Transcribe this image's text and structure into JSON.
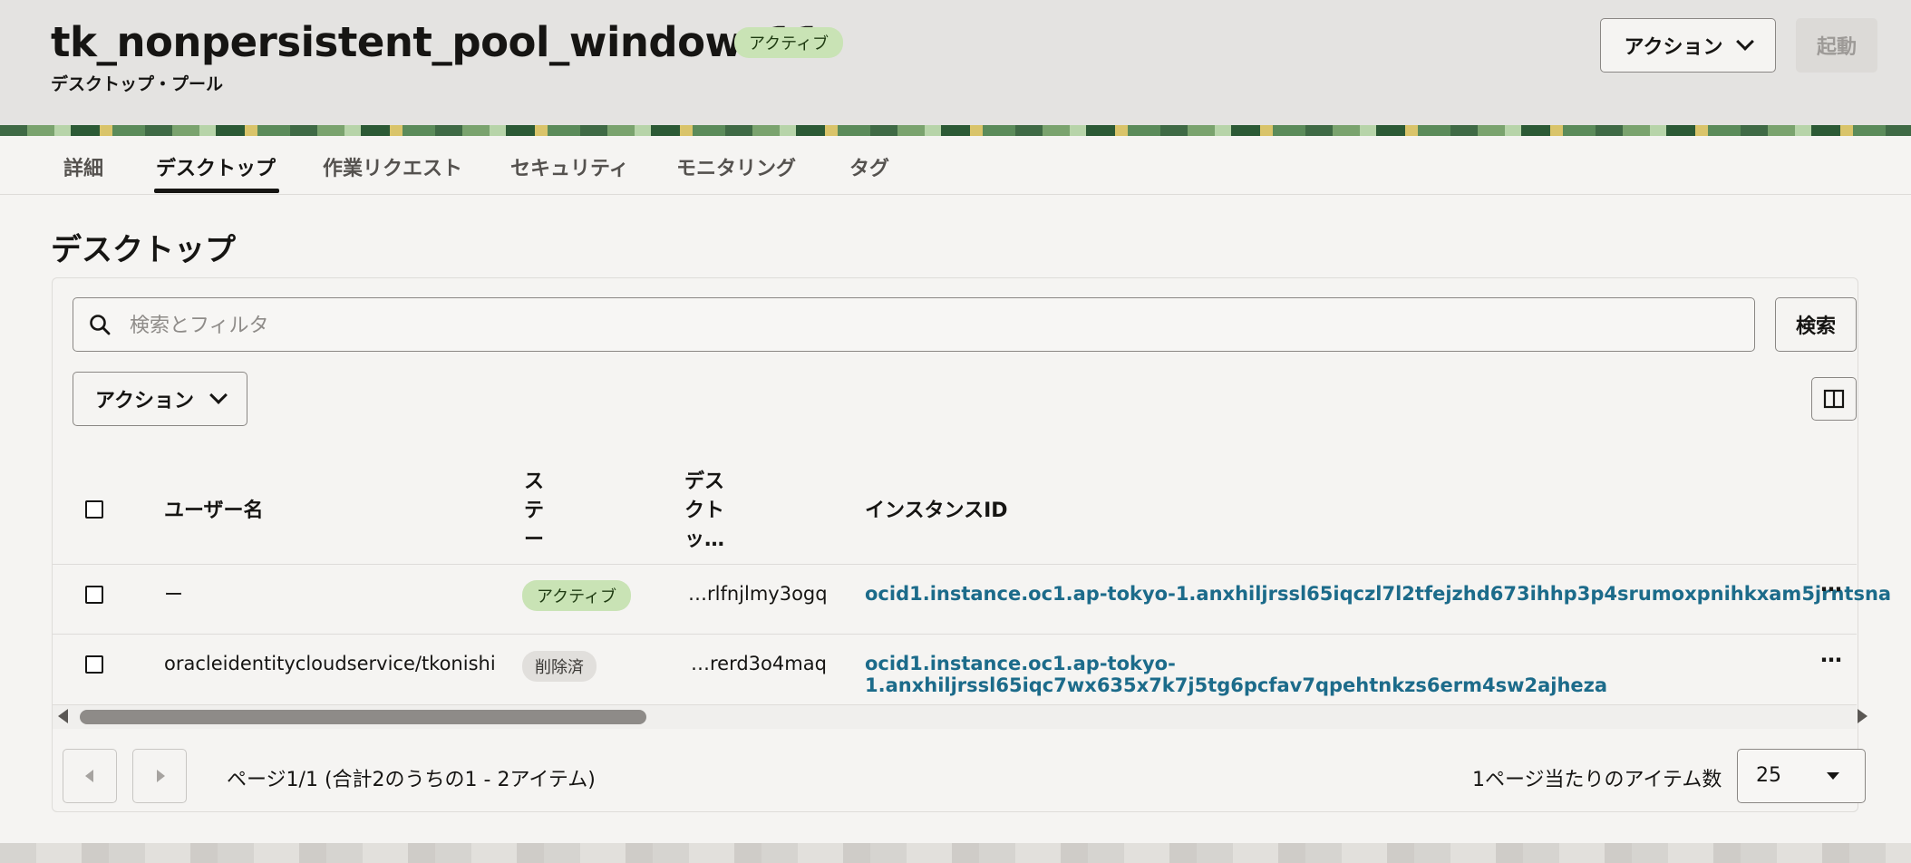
{
  "header": {
    "title": "tk_nonpersistent_pool_windows11",
    "status": "アクティブ",
    "subtitle": "デスクトップ・プール",
    "action_label": "アクション",
    "launch_label": "起動"
  },
  "tabs": [
    {
      "label": "詳細"
    },
    {
      "label": "デスクトップ"
    },
    {
      "label": "作業リクエスト"
    },
    {
      "label": "セキュリティ"
    },
    {
      "label": "モニタリング"
    },
    {
      "label": "タグ"
    }
  ],
  "section": {
    "title": "デスクトップ"
  },
  "search": {
    "placeholder": "検索とフィルタ",
    "button_label": "検索"
  },
  "table_action_label": "アクション",
  "columns": {
    "username": "ユーザー名",
    "state": "ステー",
    "desktop": "デスクトッ…",
    "instance_id": "インスタンスID"
  },
  "rows": [
    {
      "username": "ー",
      "state": "アクティブ",
      "desktop": "…rlfnjlmy3ogq",
      "instance_id": "ocid1.instance.oc1.ap-tokyo-1.anxhiljrssl65iqczl7l2tfejzhd673ihhp3p4srumoxpnihkxam5jrntsna"
    },
    {
      "username": "oracleidentitycloudservice/tkonishi",
      "state": "削除済",
      "desktop": "…rerd3o4maq",
      "instance_id": "ocid1.instance.oc1.ap-tokyo-1.anxhiljrssl65iqc7wx635x7k7j5tg6pcfav7qpehtnkzs6erm4sw2ajheza"
    }
  ],
  "pagination": {
    "summary": "ページ1/1 (合計2のうちの1 - 2アイテム)",
    "per_page_label": "1ページ当たりのアイテム数",
    "per_page_value": "25"
  },
  "icons": [
    "search-icon",
    "chevron-down-icon",
    "columns-icon",
    "more-actions-icon",
    "prev-page-icon",
    "next-page-icon"
  ],
  "colors": {
    "accent_link": "#1c6b8a",
    "active_badge": "#c9e3b5",
    "deleted_badge": "#e1dfdc"
  }
}
